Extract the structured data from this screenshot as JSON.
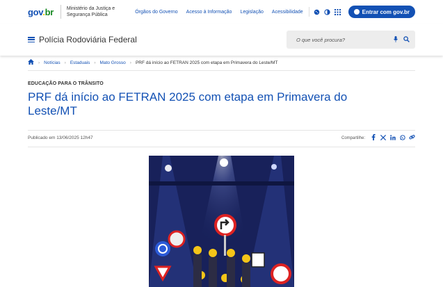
{
  "topbar": {
    "logo": {
      "g": "gov",
      "dot": ".",
      "br": "br"
    },
    "ministry_line1": "Ministério da Justiça e",
    "ministry_line2": "Segurança Pública",
    "links": [
      "Órgãos do Governo",
      "Acesso à Informação",
      "Legislação",
      "Acessibilidade"
    ],
    "login_label": "Entrar com gov.br"
  },
  "header": {
    "site_name": "Polícia Rodoviária Federal",
    "search_placeholder": "O que você procura?"
  },
  "breadcrumb": {
    "items": [
      "Notícias",
      "Estaduais",
      "Mato Grosso"
    ],
    "current": "PRF dá início ao FETRAN 2025 com etapa em Primavera do Leste/MT"
  },
  "article": {
    "kicker": "EDUCAÇÃO PARA O TRÂNSITO",
    "title": "PRF dá início ao FETRAN 2025 com etapa em Primavera do Leste/MT",
    "published": "Publicado em 13/06/2025 12h47",
    "share_label": "Compartilhe:"
  },
  "colors": {
    "primary": "#1351b4",
    "gov_yellow": "#ffcd07",
    "gov_green": "#168821"
  }
}
